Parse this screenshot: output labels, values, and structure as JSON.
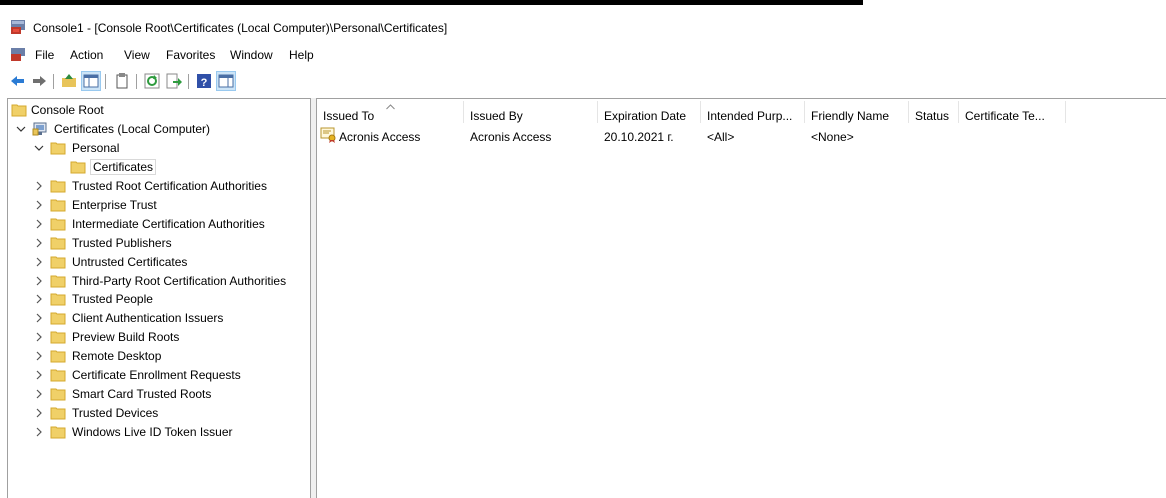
{
  "window": {
    "title": "Console1 - [Console Root\\Certificates (Local Computer)\\Personal\\Certificates]"
  },
  "menu": [
    "File",
    "Action",
    "View",
    "Favorites",
    "Window",
    "Help"
  ],
  "toolbar": {
    "buttons": [
      "back-icon",
      "forward-icon",
      "up-folder-icon",
      "show-hide-tree-icon",
      "clipboard-icon",
      "refresh-icon",
      "export-list-icon",
      "help-icon",
      "show-action-pane-icon"
    ]
  },
  "tree": {
    "root": "Console Root",
    "certs": "Certificates (Local Computer)",
    "personal": "Personal",
    "certificates": "Certificates",
    "items": [
      "Trusted Root Certification Authorities",
      "Enterprise Trust",
      "Intermediate Certification Authorities",
      "Trusted Publishers",
      "Untrusted Certificates",
      "Third-Party Root Certification Authorities",
      "Trusted People",
      "Client Authentication Issuers",
      "Preview Build Roots",
      "Remote Desktop",
      "Certificate Enrollment Requests",
      "Smart Card Trusted Roots",
      "Trusted Devices",
      "Windows Live ID Token Issuer"
    ]
  },
  "list": {
    "columns": [
      "Issued To",
      "Issued By",
      "Expiration Date",
      "Intended Purp...",
      "Friendly Name",
      "Status",
      "Certificate Te..."
    ],
    "rows": [
      [
        "Acronis Access",
        "Acronis Access",
        "20.10.2021 г.",
        "<All>",
        "<None>",
        "",
        ""
      ]
    ]
  }
}
